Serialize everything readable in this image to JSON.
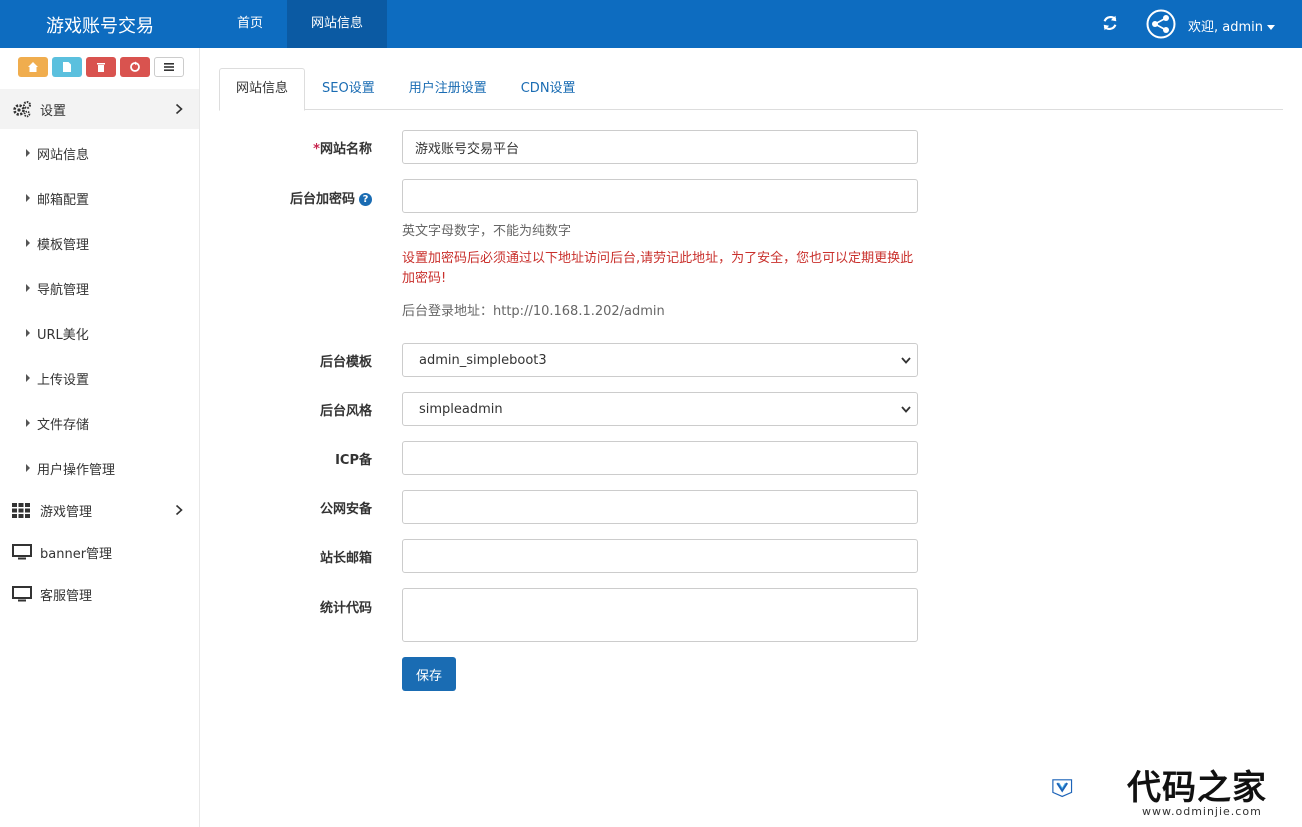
{
  "topbar": {
    "brand": "游戏账号交易",
    "nav": [
      {
        "label": "首页"
      },
      {
        "label": "网站信息"
      }
    ],
    "welcome": "欢迎, admin"
  },
  "sidebar": {
    "shortcut_icons": [
      "home-icon",
      "file-icon",
      "trash-icon",
      "recycle-icon",
      "list-icon"
    ],
    "menu": [
      {
        "label": "设置",
        "icon": "gears-icon"
      },
      {
        "label": "游戏管理",
        "icon": "grid-icon"
      },
      {
        "label": "banner管理",
        "icon": "monitor-icon"
      },
      {
        "label": "客服管理",
        "icon": "monitor-icon"
      }
    ],
    "settings_items": [
      {
        "label": "网站信息"
      },
      {
        "label": "邮箱配置"
      },
      {
        "label": "模板管理"
      },
      {
        "label": "导航管理"
      },
      {
        "label": "URL美化"
      },
      {
        "label": "上传设置"
      },
      {
        "label": "文件存储"
      },
      {
        "label": "用户操作管理"
      }
    ]
  },
  "tabs": [
    {
      "label": "网站信息"
    },
    {
      "label": "SEO设置"
    },
    {
      "label": "用户注册设置"
    },
    {
      "label": "CDN设置"
    }
  ],
  "form": {
    "site_name_label": "网站名称",
    "site_name_required": "*",
    "site_name_value": "游戏账号交易平台",
    "admin_password_label": "后台加密码",
    "admin_password_value": "",
    "admin_password_help": "英文字母数字，不能为纯数字",
    "admin_password_warning": "设置加密码后必须通过以下地址访问后台,请劳记此地址，为了安全，您也可以定期更换此加密码!",
    "admin_login_url": "后台登录地址：http://10.168.1.202/admin",
    "admin_template_label": "后台模板",
    "admin_template_value": "admin_simpleboot3",
    "admin_style_label": "后台风格",
    "admin_style_value": "simpleadmin",
    "icp_label": "ICP备",
    "public_security_label": "公网安备",
    "webmaster_email_label": "站长邮箱",
    "stats_code_label": "统计代码",
    "save_label": "保存"
  },
  "watermark": {
    "text": "代码之家",
    "url": "www.odminjie.com"
  }
}
